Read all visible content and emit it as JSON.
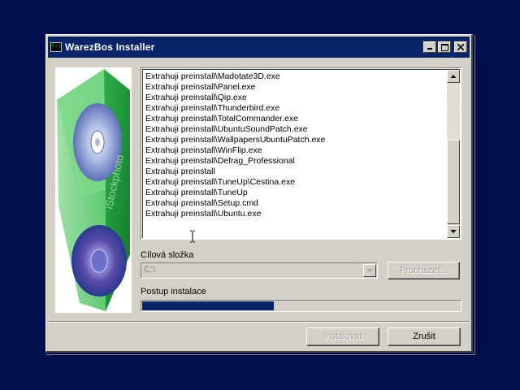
{
  "window": {
    "title": "WarezBos Installer",
    "icon": "console-icon"
  },
  "sidebar_image": {
    "icon": "cd-box-image",
    "watermark": "iStockphoto"
  },
  "log": {
    "lines": [
      "Extrahuji preinstall\\Madotate3D.exe",
      "Extrahuji preinstall\\Panel.exe",
      "Extrahuji preinstall\\Qip.exe",
      "Extrahuji preinstall\\Thunderbird.exe",
      "Extrahuji preinstall\\TotalCommander.exe",
      "Extrahuji preinstall\\UbuntuSoundPatch.exe",
      "Extrahuji preinstall\\WallpapersUbuntuPatch.exe",
      "Extrahuji preinstall\\WinFlip.exe",
      "Extrahuji preinstall\\Defrag_Professional",
      "Extrahuji preinstall",
      "Extrahuji preinstall\\TuneUp\\Cestina.exe",
      "Extrahuji preinstall\\TuneUp",
      "Extrahuji preinstall\\Setup.cmd",
      "Extrahuji preinstall\\Ubuntu.exe"
    ]
  },
  "destination": {
    "label": "Cílová složka",
    "value": "C:\\",
    "browse_label": "Procházet..."
  },
  "progress": {
    "label": "Postup instalace",
    "fraction": 0.415
  },
  "buttons": {
    "install_label": "Instalovat",
    "cancel_label": "Zrušit"
  },
  "colors": {
    "desktop": "#000f4d",
    "titlebar": "#0a246a",
    "face": "#d4d0c8",
    "progress_fill": "#0a246a"
  }
}
